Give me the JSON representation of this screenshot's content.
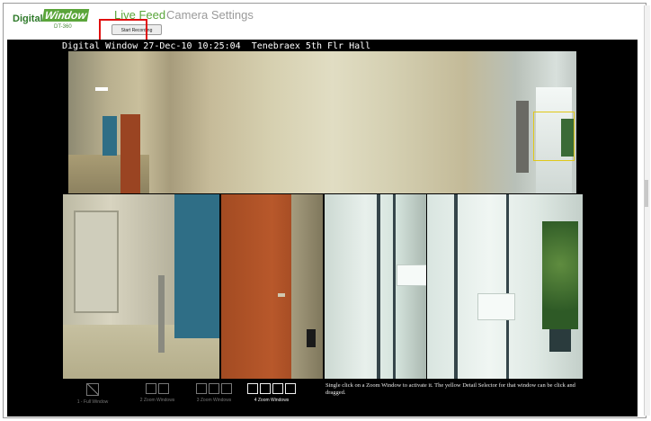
{
  "app": {
    "logo_primary": "Digital",
    "logo_secondary": "Window",
    "logo_sub": "DT-360"
  },
  "nav": {
    "live_feed": "Live Feed",
    "camera_settings": "Camera Settings"
  },
  "toolbar": {
    "record_label": "Start Recording"
  },
  "video": {
    "caption": "Digital Window 27-Dec-10 10:25:04  Tenebraex 5th Flr Hall"
  },
  "layouts": [
    {
      "label": "1 - Full Window",
      "panes": 1
    },
    {
      "label": "2 Zoom Windows",
      "panes": 2
    },
    {
      "label": "3 Zoom Windows",
      "panes": 3
    },
    {
      "label": "4 Zoom Windows",
      "panes": 4
    }
  ],
  "help_text": "Single click on a Zoom Window to activate it. The yellow Detail Selector for that window can be click and dragged.",
  "colors": {
    "brand_green": "#5aa53a",
    "nav_inactive": "#9a9a9a",
    "highlight": "#e01010",
    "detail_selector": "#e0c81a"
  }
}
